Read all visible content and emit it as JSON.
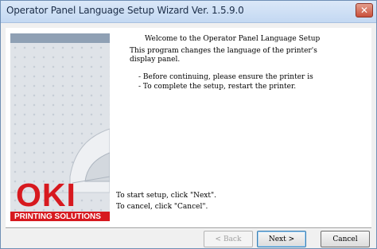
{
  "window": {
    "title": "Operator Panel Language Setup Wizard Ver. 1.5.9.0",
    "close_glyph": "✕"
  },
  "sidebar": {
    "brand": "OKI",
    "tagline": "PRINTING SOLUTIONS",
    "brand_color": "#d7191f"
  },
  "content": {
    "welcome": "Welcome to the Operator Panel Language Setup",
    "description_line1": "This program changes the language of the printer's",
    "description_line2": "display panel.",
    "bullet1": "- Before continuing, please ensure the printer is",
    "bullet2": "- To complete the setup, restart the printer.",
    "start_hint": "To start setup, click \"Next\".",
    "cancel_hint": "To cancel, click \"Cancel\"."
  },
  "buttons": {
    "back": "< Back",
    "next": "Next  >",
    "cancel": "Cancel"
  }
}
